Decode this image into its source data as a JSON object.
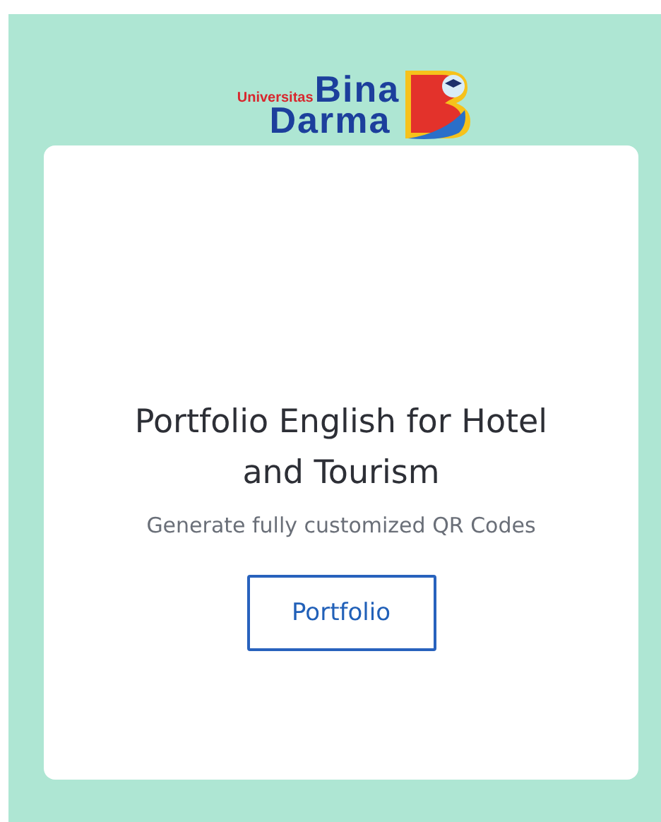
{
  "logo": {
    "prefix": "Universitas",
    "line_1": "Bina",
    "line_2": "Darma"
  },
  "card": {
    "title": "Portfolio English for Hotel and Tourism",
    "subtitle": "Generate fully customized QR Codes",
    "button": "Portfolio"
  }
}
